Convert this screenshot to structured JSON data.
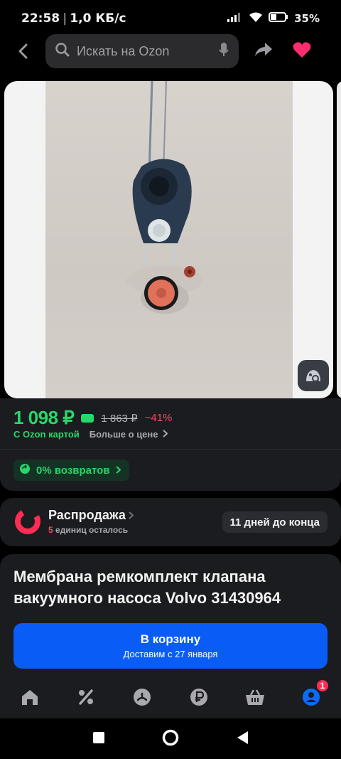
{
  "status_bar": {
    "time": "22:58",
    "network_speed": "1,0 КБ/с",
    "battery": "35%"
  },
  "search": {
    "placeholder": "Искать на Ozon"
  },
  "icons": {
    "back": "arrow-left-icon",
    "search": "search-icon",
    "mic": "microphone-icon",
    "share": "share-icon",
    "favorite": "heart-icon",
    "lens": "image-search-icon"
  },
  "price": {
    "current": "1 098 ₽",
    "old": "1 863 ₽",
    "discount": "−41%",
    "ozon_card_label": "С Ozon картой",
    "more_label": "Больше о цене"
  },
  "returns": {
    "label": "0% возвратов"
  },
  "sale": {
    "title": "Распродажа",
    "units_count": "5",
    "units_text": "единиц осталось",
    "days_left": "11 дней до конца"
  },
  "product": {
    "title": "Мембрана ремкомплект клапана вакуумного насоса Volvo 31430964"
  },
  "cart_button": {
    "label": "В корзину",
    "delivery": "Доставим с 27 января"
  },
  "bottom_nav": {
    "items": [
      "home-icon",
      "percent-icon",
      "fresh-icon",
      "ruble-icon",
      "cart-basket-icon",
      "profile-icon"
    ],
    "profile_badge": "1"
  },
  "colors": {
    "accent_green": "#27d86a",
    "accent_blue": "#0a5cf6",
    "accent_red": "#ff4468",
    "heart": "#ff2d6f"
  }
}
